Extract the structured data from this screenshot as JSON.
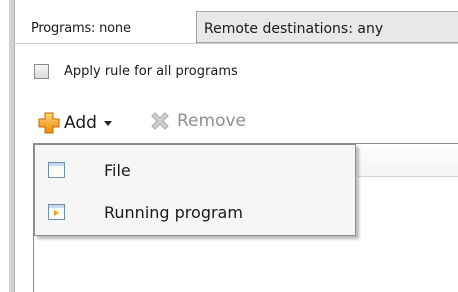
{
  "header": {
    "programs_label": "Programs: none",
    "remote_tab_label": "Remote destinations: any"
  },
  "options": {
    "apply_all_label": "Apply rule for all programs",
    "apply_all_checked": false
  },
  "toolbar": {
    "add_label": "Add",
    "remove_label": "Remove",
    "remove_enabled": false
  },
  "add_menu": {
    "items": [
      {
        "label": "File",
        "icon": "file-icon"
      },
      {
        "label": "Running program",
        "icon": "running-program-icon"
      }
    ]
  },
  "colors": {
    "accent_orange": "#f5a623",
    "disabled_gray": "#8f8f8f"
  }
}
